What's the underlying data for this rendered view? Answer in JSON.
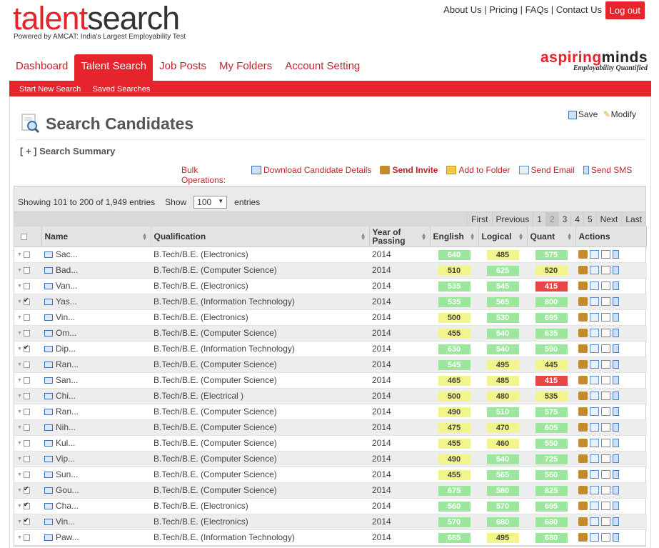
{
  "header": {
    "logo_part1": "talent",
    "logo_part2": "search",
    "powered": "Powered by AMCAT: India's Largest Employability Test",
    "links": "About Us | Pricing | FAQs | Contact Us",
    "logout": "Log out",
    "brand_main": "aspiring",
    "brand_bold": "minds",
    "brand_tagline": "Employability Quantified"
  },
  "nav": {
    "tabs": [
      "Dashboard",
      "Talent Search",
      "Job Posts",
      "My Folders",
      "Account Setting"
    ],
    "active": 1,
    "sub": [
      "Start New Search",
      "Saved Searches"
    ]
  },
  "page": {
    "title": "Search Candidates",
    "save": "Save",
    "modify": "Modify",
    "summary": "[ + ] Search Summary",
    "bulk_label": "Bulk Operations:",
    "bulk_ops": [
      "Download Candidate Details",
      "Send Invite",
      "Add to Folder",
      "Send Email",
      "Send SMS"
    ]
  },
  "table_info": {
    "showing": "Showing 101 to 200 of 1,949 entries",
    "show": "Show",
    "page_size": "100",
    "entries": "entries"
  },
  "pager": [
    "First",
    "Previous",
    "1",
    "2",
    "3",
    "4",
    "5",
    "Next",
    "Last"
  ],
  "pager_current": "2",
  "columns": [
    "Name",
    "Qualification",
    "Year of Passing",
    "English",
    "Logical",
    "Quant",
    "Actions"
  ],
  "colors": {
    "accent": "#e5242b",
    "score_high": "#9de69d",
    "score_mid": "#f2f58b",
    "score_low": "#e84545"
  },
  "rows": [
    {
      "name": "Sac...",
      "qual": "B.Tech/B.E. (Electronics)",
      "year": "2014",
      "eng": "640",
      "log": "485",
      "quant": "575",
      "checked": false,
      "ec": "green",
      "lc": "yellow",
      "qc": "green"
    },
    {
      "name": "Bad...",
      "qual": "B.Tech/B.E. (Computer Science)",
      "year": "2014",
      "eng": "510",
      "log": "625",
      "quant": "520",
      "checked": false,
      "ec": "yellow",
      "lc": "green",
      "qc": "yellow"
    },
    {
      "name": "Van...",
      "qual": "B.Tech/B.E. (Electronics)",
      "year": "2014",
      "eng": "535",
      "log": "545",
      "quant": "415",
      "checked": false,
      "ec": "green",
      "lc": "green",
      "qc": "red"
    },
    {
      "name": "Yas...",
      "qual": "B.Tech/B.E. (Information Technology)",
      "year": "2014",
      "eng": "535",
      "log": "565",
      "quant": "800",
      "checked": true,
      "ec": "green",
      "lc": "green",
      "qc": "green"
    },
    {
      "name": "Vin...",
      "qual": "B.Tech/B.E. (Electronics)",
      "year": "2014",
      "eng": "500",
      "log": "530",
      "quant": "695",
      "checked": false,
      "ec": "yellow",
      "lc": "green",
      "qc": "green"
    },
    {
      "name": "Om...",
      "qual": "B.Tech/B.E. (Computer Science)",
      "year": "2014",
      "eng": "455",
      "log": "540",
      "quant": "635",
      "checked": false,
      "ec": "yellow",
      "lc": "green",
      "qc": "green"
    },
    {
      "name": "Dip...",
      "qual": "B.Tech/B.E. (Information Technology)",
      "year": "2014",
      "eng": "630",
      "log": "540",
      "quant": "590",
      "checked": true,
      "ec": "green",
      "lc": "green",
      "qc": "green"
    },
    {
      "name": "Ran...",
      "qual": "B.Tech/B.E. (Computer Science)",
      "year": "2014",
      "eng": "545",
      "log": "495",
      "quant": "445",
      "checked": false,
      "ec": "green",
      "lc": "yellow",
      "qc": "yellow"
    },
    {
      "name": "San...",
      "qual": "B.Tech/B.E. (Computer Science)",
      "year": "2014",
      "eng": "465",
      "log": "485",
      "quant": "415",
      "checked": false,
      "ec": "yellow",
      "lc": "yellow",
      "qc": "red"
    },
    {
      "name": "Chi...",
      "qual": "B.Tech/B.E. (Electrical )",
      "year": "2014",
      "eng": "500",
      "log": "480",
      "quant": "535",
      "checked": false,
      "ec": "yellow",
      "lc": "yellow",
      "qc": "yellow"
    },
    {
      "name": "Ran...",
      "qual": "B.Tech/B.E. (Computer Science)",
      "year": "2014",
      "eng": "490",
      "log": "510",
      "quant": "575",
      "checked": false,
      "ec": "yellow",
      "lc": "green",
      "qc": "green"
    },
    {
      "name": "Nih...",
      "qual": "B.Tech/B.E. (Computer Science)",
      "year": "2014",
      "eng": "475",
      "log": "470",
      "quant": "605",
      "checked": false,
      "ec": "yellow",
      "lc": "yellow",
      "qc": "green"
    },
    {
      "name": "Kul...",
      "qual": "B.Tech/B.E. (Computer Science)",
      "year": "2014",
      "eng": "455",
      "log": "460",
      "quant": "550",
      "checked": false,
      "ec": "yellow",
      "lc": "yellow",
      "qc": "green"
    },
    {
      "name": "Vip...",
      "qual": "B.Tech/B.E. (Computer Science)",
      "year": "2014",
      "eng": "490",
      "log": "540",
      "quant": "725",
      "checked": false,
      "ec": "yellow",
      "lc": "green",
      "qc": "green"
    },
    {
      "name": "Sun...",
      "qual": "B.Tech/B.E. (Computer Science)",
      "year": "2014",
      "eng": "455",
      "log": "565",
      "quant": "560",
      "checked": false,
      "ec": "yellow",
      "lc": "green",
      "qc": "green"
    },
    {
      "name": "Gou...",
      "qual": "B.Tech/B.E. (Computer Science)",
      "year": "2014",
      "eng": "675",
      "log": "580",
      "quant": "825",
      "checked": true,
      "ec": "green",
      "lc": "green",
      "qc": "green"
    },
    {
      "name": "Cha...",
      "qual": "B.Tech/B.E. (Electronics)",
      "year": "2014",
      "eng": "560",
      "log": "570",
      "quant": "695",
      "checked": true,
      "ec": "green",
      "lc": "green",
      "qc": "green"
    },
    {
      "name": "Vin...",
      "qual": "B.Tech/B.E. (Electronics)",
      "year": "2014",
      "eng": "570",
      "log": "680",
      "quant": "680",
      "checked": true,
      "ec": "green",
      "lc": "green",
      "qc": "green"
    },
    {
      "name": "Paw...",
      "qual": "B.Tech/B.E. (Information Technology)",
      "year": "2014",
      "eng": "665",
      "log": "495",
      "quant": "680",
      "checked": false,
      "ec": "green",
      "lc": "yellow",
      "qc": "green"
    }
  ]
}
